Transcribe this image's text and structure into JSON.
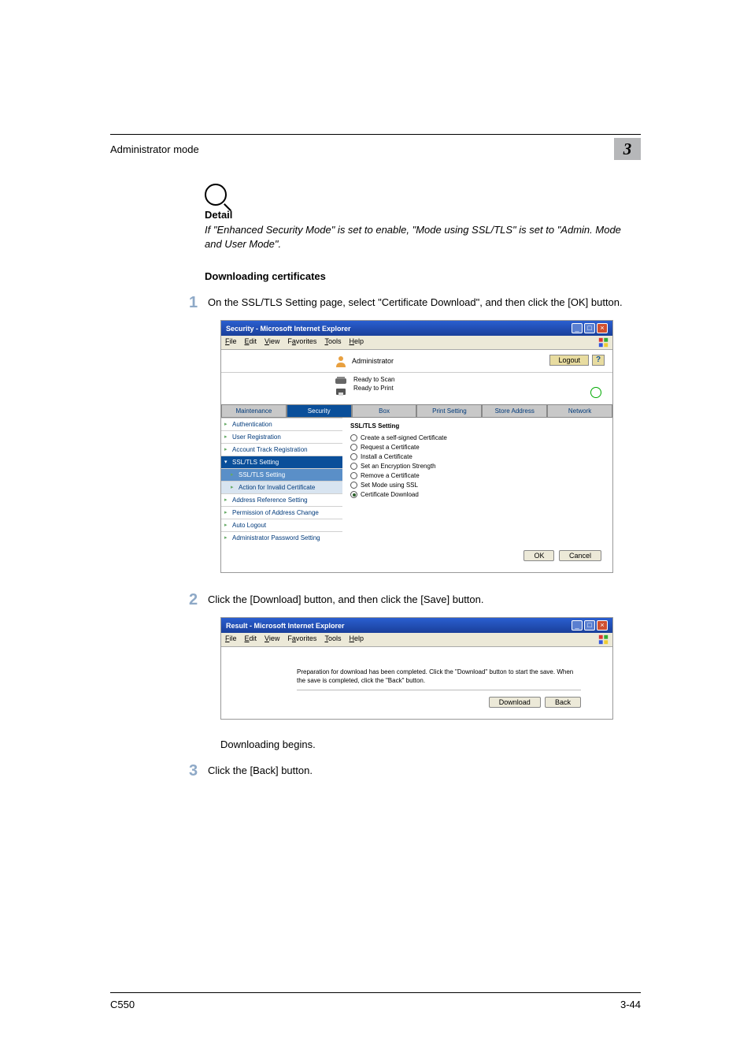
{
  "header": {
    "title": "Administrator mode",
    "chapter": "3"
  },
  "detail": {
    "heading": "Detail",
    "text": "If \"Enhanced Security Mode\" is set to enable, \"Mode using SSL/TLS\" is set to \"Admin. Mode and User Mode\"."
  },
  "section_heading": "Downloading certificates",
  "steps": {
    "s1_num": "1",
    "s1_text": "On the SSL/TLS Setting page, select \"Certificate Download\", and then click the [OK] button.",
    "s2_num": "2",
    "s2_text": "Click the [Download] button, and then click the [Save] button.",
    "s3_num": "3",
    "s3_text": "Click the [Back] button.",
    "after_s2": "Downloading begins."
  },
  "shot1": {
    "title": "Security - Microsoft Internet Explorer",
    "menu": {
      "file": "File",
      "edit": "Edit",
      "view": "View",
      "fav": "Favorites",
      "tools": "Tools",
      "help": "Help"
    },
    "admin": "Administrator",
    "logout": "Logout",
    "help": "?",
    "status1": "Ready to Scan",
    "status2": "Ready to Print",
    "tabs": {
      "maint": "Maintenance",
      "sec": "Security",
      "box": "Box",
      "print": "Print Setting",
      "store": "Store Address",
      "net": "Network"
    },
    "nav": {
      "auth": "Authentication",
      "ureg": "User Registration",
      "atrack": "Account Track Registration",
      "ssl": "SSL/TLS Setting",
      "ssl_sub": "SSL/TLS Setting",
      "action": "Action for Invalid Certificate",
      "addr": "Address Reference Setting",
      "perm": "Permission of Address Change",
      "auto": "Auto Logout",
      "apass": "Administrator Password Setting"
    },
    "main_hd": "SSL/TLS Setting",
    "radios": {
      "r1": "Create a self-signed Certificate",
      "r2": "Request a Certificate",
      "r3": "Install a Certificate",
      "r4": "Set an Encryption Strength",
      "r5": "Remove a Certificate",
      "r6": "Set Mode using SSL",
      "r7": "Certificate Download"
    },
    "ok": "OK",
    "cancel": "Cancel"
  },
  "shot2": {
    "title": "Result - Microsoft Internet Explorer",
    "message": "Preparation for download has been completed. Click the \"Download\" button to start the save. When the save is completed, click the \"Back\" button.",
    "download": "Download",
    "back": "Back"
  },
  "footer": {
    "model": "C550",
    "page": "3-44"
  }
}
